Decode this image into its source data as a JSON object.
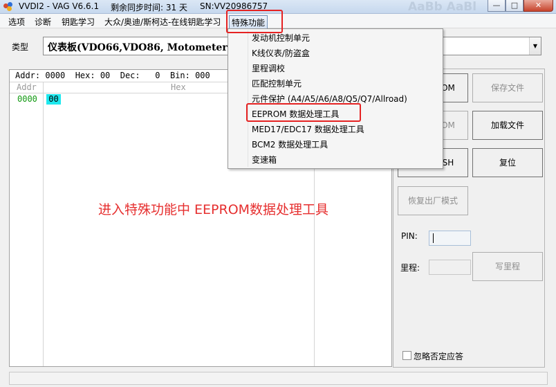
{
  "window": {
    "title": "VVDI2 - VAG V6.6.1",
    "sync_time": "剩余同步时间: 31 天",
    "serial": "SN:VV20986757",
    "ghost_text": "AaBb AaBl"
  },
  "menu": {
    "items": [
      "选项",
      "诊断",
      "钥匙学习",
      "大众/奥迪/斯柯达-在线钥匙学习",
      "特殊功能"
    ]
  },
  "special_functions_menu": {
    "items": [
      "发动机控制单元",
      "K线仪表/防盗盒",
      "里程调校",
      "匹配控制单元",
      "元件保护 (A4/A5/A6/A8/Q5/Q7/Allroad)",
      "EEPROM 数据处理工具",
      "MED17/EDC17 数据处理工具",
      "BCM2 数据处理工具",
      "变速箱"
    ],
    "highlighted": "EEPROM 数据处理工具"
  },
  "type_row": {
    "label": "类型",
    "selected": "仪表板(VDO66,VDO86, Motometer)"
  },
  "hex_view": {
    "info_line": "Addr: 0000  Hex: 00  Dec:   0  Bin: 000",
    "col_addr": "Addr",
    "col_hex": "Hex",
    "rows": [
      {
        "addr": "0000",
        "bytes": [
          "00"
        ]
      }
    ]
  },
  "annotation": "进入特殊功能中   EEPROM数据处理工具",
  "side_panel": {
    "buttons": {
      "read_eeprom_partial": "OM",
      "save_file": "保存文件",
      "write_eeprom_partial": "OM",
      "load_file": "加载文件",
      "flash_partial": "SH",
      "reset": "复位",
      "restore_factory": "恢复出厂模式",
      "write_km": "写里程"
    },
    "pin_label": "PIN:",
    "pin_value": "",
    "km_label": "里程:",
    "km_value": "",
    "ignore_negative_label": "忽略否定应答",
    "ignore_negative_checked": false
  },
  "colors": {
    "highlight_red": "#e52222",
    "annotation_red": "#e62f2f",
    "addr_green": "#119911",
    "selected_byte_bg": "#1ee8ee"
  }
}
